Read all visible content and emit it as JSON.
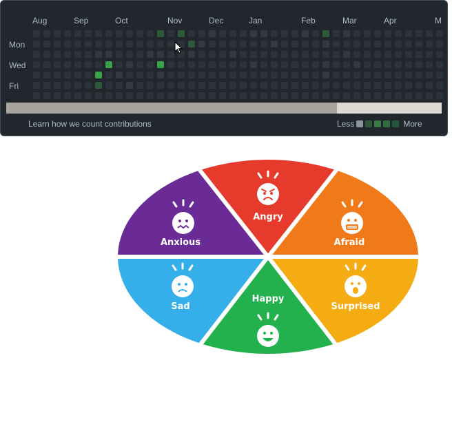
{
  "contributions": {
    "months": [
      "Aug",
      "Sep",
      "Oct",
      "Nov",
      "Dec",
      "Jan",
      "Feb",
      "Mar",
      "Apr",
      "M"
    ],
    "days": [
      "Mon",
      "Wed",
      "Fri"
    ],
    "learn_link": "Learn how we count contributions",
    "legend_less": "Less",
    "legend_more": "More",
    "levels": [
      "#2d333b",
      "#0e4429",
      "#006d32",
      "#26a641",
      "#39d353"
    ]
  },
  "emotion_wheel": {
    "segments": [
      {
        "label": "Angry",
        "color": "#e53a2c",
        "face": "angry-face-icon"
      },
      {
        "label": "Afraid",
        "color": "#f07a1a",
        "face": "afraid-face-icon"
      },
      {
        "label": "Surprised",
        "color": "#f4ac12",
        "face": "surprised-face-icon"
      },
      {
        "label": "Happy",
        "color": "#22b14c",
        "face": "happy-face-icon"
      },
      {
        "label": "Sad",
        "color": "#34afe9",
        "face": "sad-face-icon"
      },
      {
        "label": "Anxious",
        "color": "#6a2b96",
        "face": "anxious-face-icon"
      }
    ]
  }
}
